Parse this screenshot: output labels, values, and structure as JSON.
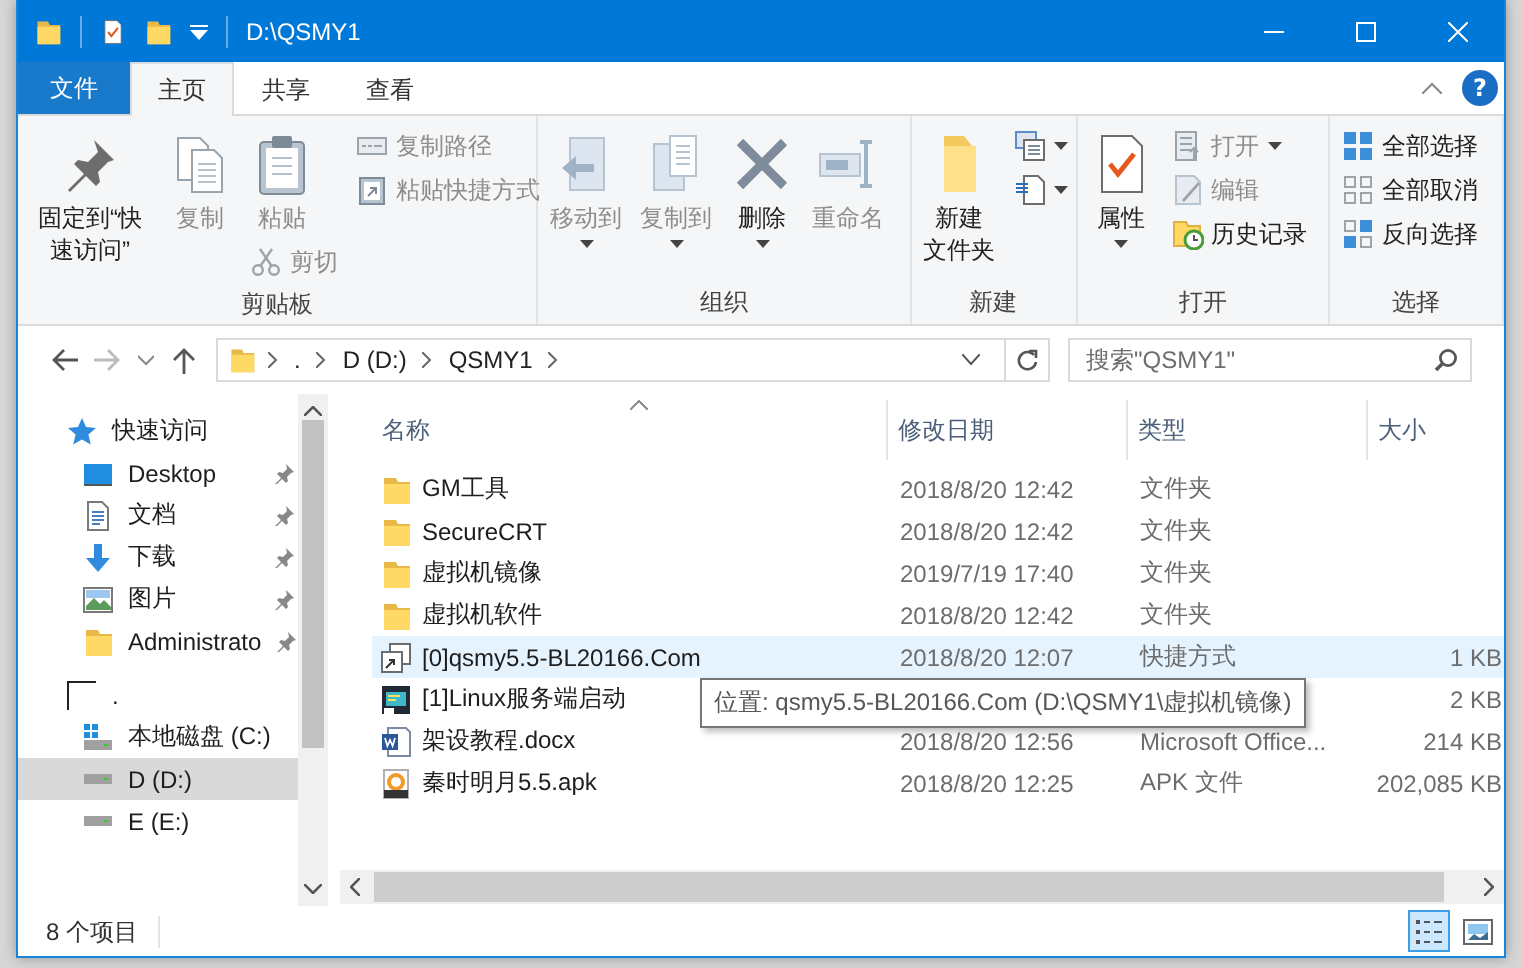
{
  "title_bar": {
    "title": "D:\\QSMY1"
  },
  "ribbon_tabs": [
    {
      "label": "文件",
      "kind": "file",
      "selected": false
    },
    {
      "label": "主页",
      "kind": "tab",
      "selected": true
    },
    {
      "label": "共享",
      "kind": "tab",
      "selected": false
    },
    {
      "label": "查看",
      "kind": "tab",
      "selected": false
    }
  ],
  "help_button": {
    "label": "?"
  },
  "ribbon_groups": [
    {
      "title": "剪贴板",
      "columns": [
        [
          {
            "label": "固定到“快速访问”",
            "kind": "large",
            "disabled": false
          }
        ],
        [
          {
            "label": "复制",
            "kind": "large",
            "disabled": true
          }
        ],
        [
          {
            "label": "粘贴",
            "kind": "large",
            "disabled": true
          },
          {
            "label": "剪切",
            "kind": "small",
            "disabled": true
          }
        ],
        [
          {
            "label": "复制路径",
            "kind": "small",
            "disabled": true
          },
          {
            "label": "粘贴快捷方式",
            "kind": "small",
            "disabled": true
          }
        ]
      ]
    },
    {
      "title": "组织",
      "columns": [
        [
          {
            "label": "移动到",
            "kind": "large",
            "disabled": true,
            "dropdown": true
          }
        ],
        [
          {
            "label": "复制到",
            "kind": "large",
            "disabled": true,
            "dropdown": true
          }
        ],
        [
          {
            "label": "删除",
            "kind": "large",
            "disabled": false,
            "dropdown": true
          }
        ],
        [
          {
            "label": "重命名",
            "kind": "large",
            "disabled": true
          }
        ]
      ]
    },
    {
      "title": "新建",
      "columns": [
        [
          {
            "label": "新建文件夹",
            "kind": "large",
            "disabled": false
          }
        ],
        [
          {
            "kind": "small",
            "dropdown": true
          },
          {
            "kind": "small",
            "dropdown": true
          }
        ]
      ]
    },
    {
      "title": "打开",
      "columns": [
        [
          {
            "label": "属性",
            "kind": "large",
            "disabled": false,
            "dropdown": true
          }
        ],
        [
          {
            "label": "打开",
            "kind": "small",
            "disabled": true,
            "dropdown": true
          },
          {
            "label": "编辑",
            "kind": "small",
            "disabled": true
          },
          {
            "label": "历史记录",
            "kind": "small",
            "disabled": false
          }
        ]
      ]
    },
    {
      "title": "选择",
      "columns": [
        [
          {
            "label": "全部选择",
            "kind": "small",
            "disabled": false
          },
          {
            "label": "全部取消",
            "kind": "small",
            "disabled": false
          },
          {
            "label": "反向选择",
            "kind": "small",
            "disabled": false
          }
        ]
      ]
    }
  ],
  "address_bar": {
    "breadcrumbs": [
      ".",
      "D (D:)",
      "QSMY1"
    ]
  },
  "search": {
    "placeholder": "搜索\"QSMY1\""
  },
  "nav_pane": {
    "items": [
      {
        "label": "快速访问",
        "kind": "star",
        "selected": false,
        "children": [
          {
            "label": "Desktop",
            "kind": "desktop",
            "pinned": true,
            "selected": false
          },
          {
            "label": "文档",
            "kind": "document",
            "pinned": true,
            "selected": false
          },
          {
            "label": "下载",
            "kind": "download",
            "pinned": true,
            "selected": false
          },
          {
            "label": "图片",
            "kind": "pictures",
            "pinned": true,
            "selected": false
          },
          {
            "label": "Administrato",
            "kind": "folder",
            "pinned": true,
            "selected": false
          }
        ]
      },
      {
        "label": ".",
        "kind": "blank",
        "selected": false,
        "children": [
          {
            "label": "本地磁盘 (C:)",
            "kind": "system-drive",
            "selected": false
          },
          {
            "label": "D (D:)",
            "kind": "drive",
            "selected": true
          },
          {
            "label": "E (E:)",
            "kind": "drive",
            "selected": false
          }
        ]
      }
    ]
  },
  "file_list": {
    "columns": [
      {
        "label": "名称",
        "sorted": true
      },
      {
        "label": "修改日期",
        "sorted": false
      },
      {
        "label": "类型",
        "sorted": false
      },
      {
        "label": "大小",
        "sorted": false
      }
    ],
    "rows": [
      {
        "name": "GM工具",
        "date": "2018/8/20 12:42",
        "type": "文件夹",
        "kind": "folder",
        "highlighted": false
      },
      {
        "name": "SecureCRT",
        "date": "2018/8/20 12:42",
        "type": "文件夹",
        "kind": "folder",
        "highlighted": false
      },
      {
        "name": "虚拟机镜像",
        "date": "2019/7/19 17:40",
        "type": "文件夹",
        "kind": "folder",
        "highlighted": false
      },
      {
        "name": "虚拟机软件",
        "date": "2018/8/20 12:42",
        "type": "文件夹",
        "kind": "folder",
        "highlighted": false
      },
      {
        "name": "[0]qsmy5.5-BL20166.Com",
        "date": "2018/8/20 12:07",
        "type": "快捷方式",
        "size": "1 KB",
        "kind": "shortcut",
        "highlighted": true
      },
      {
        "name": "[1]Linux服务端启动",
        "size": "2 KB",
        "kind": "console",
        "highlighted": false
      },
      {
        "name": "架设教程.docx",
        "date": "2018/8/20 12:56",
        "type": "Microsoft Office...",
        "size": "214 KB",
        "kind": "word",
        "highlighted": false
      },
      {
        "name": "秦时明月5.5.apk",
        "date": "2018/8/20 12:25",
        "type": "APK 文件",
        "size": "202,085 KB",
        "kind": "apk",
        "highlighted": false
      }
    ],
    "tooltip": {
      "text": "位置: qsmy5.5-BL20166.Com (D:\\QSMY1\\虚拟机镜像)"
    }
  },
  "status_bar": {
    "item_count": "8 个项目",
    "views": [
      {
        "kind": "details",
        "selected": true
      },
      {
        "kind": "large-icons",
        "selected": false
      }
    ]
  }
}
